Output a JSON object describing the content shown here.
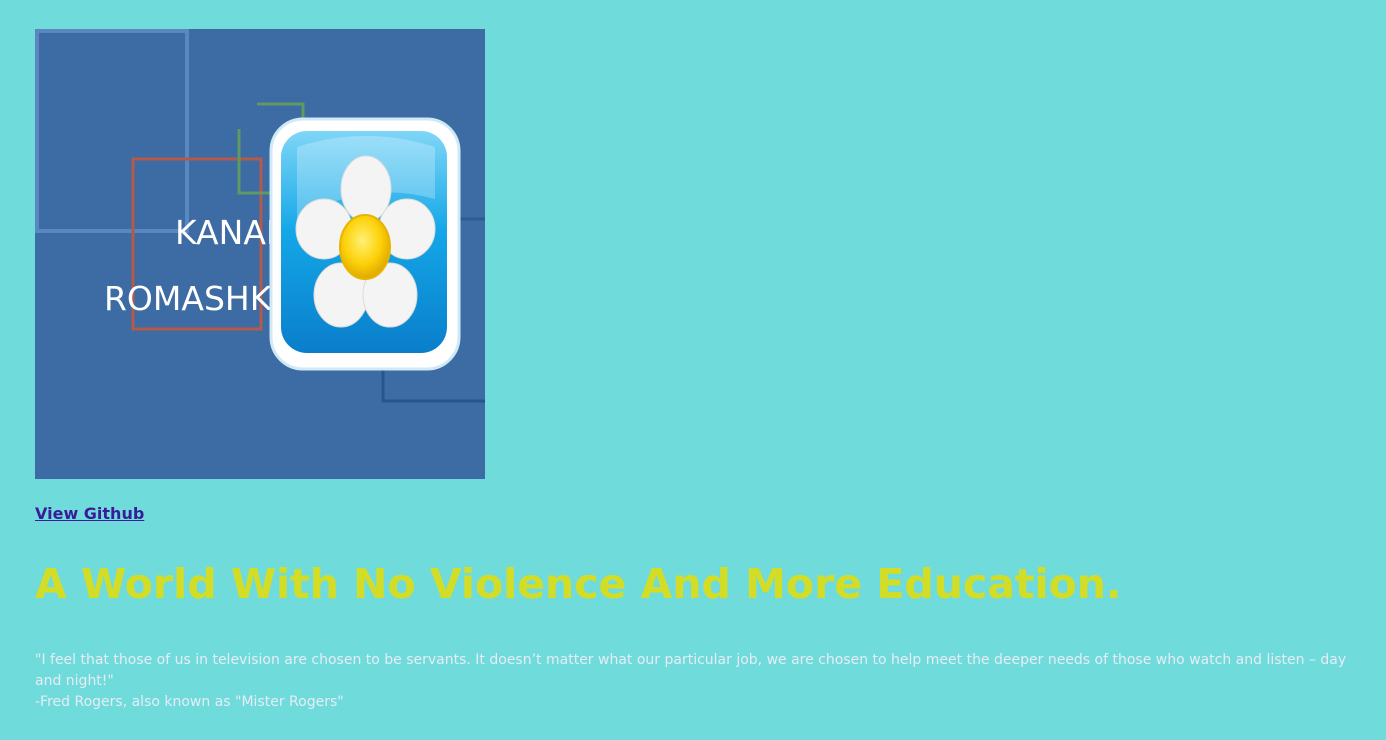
{
  "logo": {
    "line1": "KANAL",
    "line2": "ROMASHKA"
  },
  "github_link": "View Github",
  "headline": "A World With No Violence And More Education.",
  "quote": {
    "text": "\"I feel that those of us in television are chosen to be servants. It doesn’t matter what our particular job, we are chosen to help meet the deeper needs of those who watch and listen – day and night!\"",
    "attribution": "-Fred Rogers, also known as \"Mister Rogers\""
  },
  "colors": {
    "background": "#70dbdb",
    "headline": "#d4dd25",
    "link": "#3a1c9a",
    "logo_background": "#3d6ba3"
  }
}
